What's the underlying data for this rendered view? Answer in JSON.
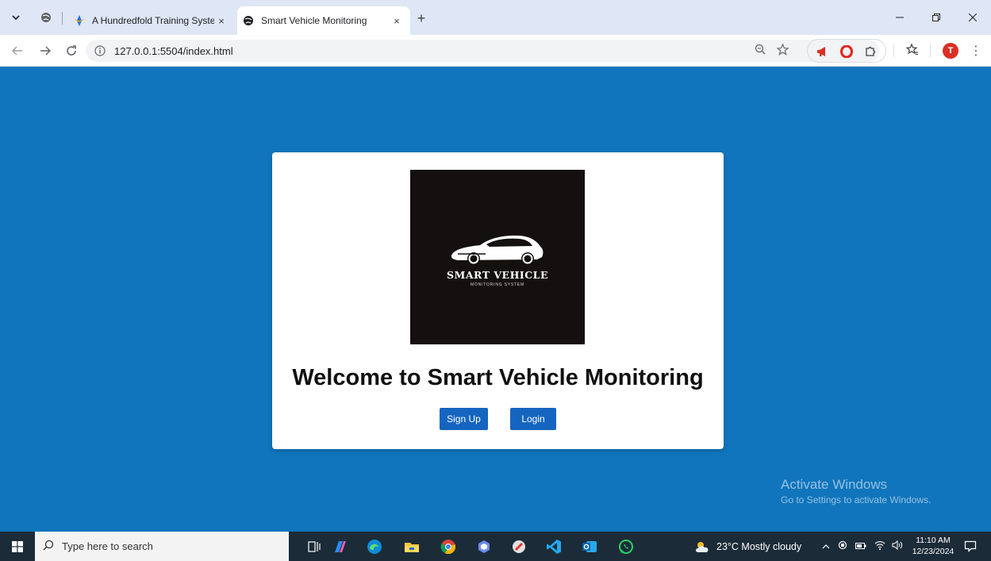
{
  "browser": {
    "tabs": [
      {
        "title": "A Hundredfold Training System"
      },
      {
        "title": "Smart Vehicle Monitoring"
      }
    ],
    "close_glyph": "×",
    "new_tab_glyph": "+",
    "url": "127.0.0.1:5504/index.html",
    "profile_initial": "T"
  },
  "page": {
    "logo": {
      "brand": "SMART VEHICLE",
      "tagline": "MONITORING SYSTEM"
    },
    "heading": "Welcome to Smart Vehicle Monitoring",
    "buttons": {
      "signup": "Sign Up",
      "login": "Login"
    },
    "background_color": "#1075bc",
    "button_color": "#1565c0"
  },
  "watermark": {
    "title": "Activate Windows",
    "subtitle": "Go to Settings to activate Windows."
  },
  "taskbar": {
    "search_placeholder": "Type here to search",
    "weather": "23°C  Mostly cloudy",
    "time": "11:10 AM",
    "date": "12/23/2024"
  }
}
